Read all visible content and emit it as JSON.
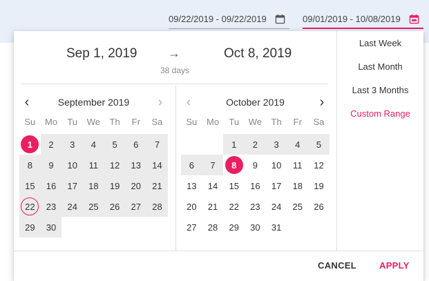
{
  "topbar": {
    "field1": {
      "value": "09/22/2019 - 09/22/2019",
      "icon": "calendar-icon"
    },
    "field2": {
      "value": "09/01/2019 - 10/08/2019",
      "icon": "calendar-icon",
      "accent": "#e91e63"
    }
  },
  "header": {
    "start": "Sep 1, 2019",
    "arrow": "→",
    "end": "Oct 8, 2019",
    "days": "38 days"
  },
  "weekdays": [
    "Su",
    "Mo",
    "Tu",
    "We",
    "Th",
    "Fr",
    "Sa"
  ],
  "months": [
    {
      "title": "September 2019",
      "prev": "‹",
      "next": "›",
      "prev_enabled": true,
      "next_enabled": false,
      "weeks": [
        [
          {
            "d": "1",
            "s": "selected"
          },
          {
            "d": "2",
            "s": "r"
          },
          {
            "d": "3",
            "s": "r"
          },
          {
            "d": "4",
            "s": "r"
          },
          {
            "d": "5",
            "s": "r"
          },
          {
            "d": "6",
            "s": "r"
          },
          {
            "d": "7",
            "s": "r"
          }
        ],
        [
          {
            "d": "8",
            "s": "r"
          },
          {
            "d": "9",
            "s": "r"
          },
          {
            "d": "10",
            "s": "r"
          },
          {
            "d": "11",
            "s": "r"
          },
          {
            "d": "12",
            "s": "r"
          },
          {
            "d": "13",
            "s": "r"
          },
          {
            "d": "14",
            "s": "r"
          }
        ],
        [
          {
            "d": "15",
            "s": "r"
          },
          {
            "d": "16",
            "s": "r"
          },
          {
            "d": "17",
            "s": "r"
          },
          {
            "d": "18",
            "s": "r"
          },
          {
            "d": "19",
            "s": "r"
          },
          {
            "d": "20",
            "s": "r"
          },
          {
            "d": "21",
            "s": "r"
          }
        ],
        [
          {
            "d": "22",
            "s": "today"
          },
          {
            "d": "23",
            "s": "r"
          },
          {
            "d": "24",
            "s": "r"
          },
          {
            "d": "25",
            "s": "r"
          },
          {
            "d": "26",
            "s": "r"
          },
          {
            "d": "27",
            "s": "r"
          },
          {
            "d": "28",
            "s": "r"
          }
        ],
        [
          {
            "d": "29",
            "s": "r"
          },
          {
            "d": "30",
            "s": "r"
          },
          {
            "d": "",
            "s": "e"
          },
          {
            "d": "",
            "s": "e"
          },
          {
            "d": "",
            "s": "e"
          },
          {
            "d": "",
            "s": "e"
          },
          {
            "d": "",
            "s": "e"
          }
        ]
      ]
    },
    {
      "title": "October 2019",
      "prev": "‹",
      "next": "›",
      "prev_enabled": false,
      "next_enabled": true,
      "weeks": [
        [
          {
            "d": "",
            "s": "e"
          },
          {
            "d": "",
            "s": "e"
          },
          {
            "d": "1",
            "s": "r"
          },
          {
            "d": "2",
            "s": "r"
          },
          {
            "d": "3",
            "s": "r"
          },
          {
            "d": "4",
            "s": "r"
          },
          {
            "d": "5",
            "s": "r"
          }
        ],
        [
          {
            "d": "6",
            "s": "r"
          },
          {
            "d": "7",
            "s": "r"
          },
          {
            "d": "8",
            "s": "selected"
          },
          {
            "d": "9",
            "s": "n"
          },
          {
            "d": "10",
            "s": "n"
          },
          {
            "d": "11",
            "s": "n"
          },
          {
            "d": "12",
            "s": "n"
          }
        ],
        [
          {
            "d": "13",
            "s": "n"
          },
          {
            "d": "14",
            "s": "n"
          },
          {
            "d": "15",
            "s": "n"
          },
          {
            "d": "16",
            "s": "n"
          },
          {
            "d": "17",
            "s": "n"
          },
          {
            "d": "18",
            "s": "n"
          },
          {
            "d": "19",
            "s": "n"
          }
        ],
        [
          {
            "d": "20",
            "s": "n"
          },
          {
            "d": "21",
            "s": "n"
          },
          {
            "d": "22",
            "s": "n"
          },
          {
            "d": "23",
            "s": "n"
          },
          {
            "d": "24",
            "s": "n"
          },
          {
            "d": "25",
            "s": "n"
          },
          {
            "d": "26",
            "s": "n"
          }
        ],
        [
          {
            "d": "27",
            "s": "n"
          },
          {
            "d": "28",
            "s": "n"
          },
          {
            "d": "29",
            "s": "n"
          },
          {
            "d": "30",
            "s": "n"
          },
          {
            "d": "31",
            "s": "n"
          },
          {
            "d": "",
            "s": "e"
          },
          {
            "d": "",
            "s": "e"
          }
        ]
      ]
    }
  ],
  "presets": [
    {
      "label": "Last Week",
      "active": false
    },
    {
      "label": "Last Month",
      "active": false
    },
    {
      "label": "Last 3 Months",
      "active": false
    },
    {
      "label": "Custom Range",
      "active": true
    }
  ],
  "actions": {
    "cancel": "CANCEL",
    "apply": "APPLY"
  },
  "colors": {
    "accent": "#e91e63",
    "range": "#ebebeb",
    "topbar": "#e8eff8"
  }
}
